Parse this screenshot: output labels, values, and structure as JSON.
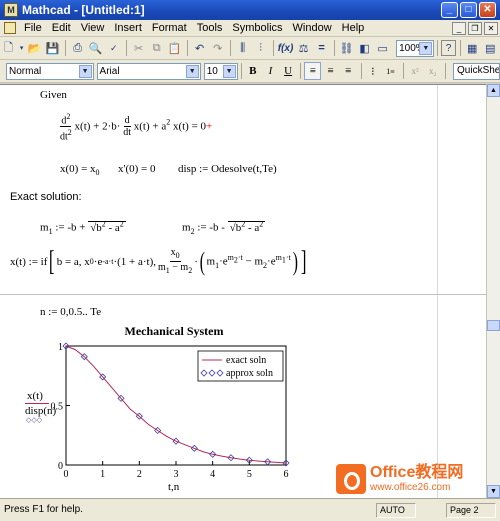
{
  "window": {
    "title": "Mathcad - [Untitled:1]",
    "app_icon": "mathcad-icon"
  },
  "menu": {
    "items": [
      "File",
      "Edit",
      "View",
      "Insert",
      "Format",
      "Tools",
      "Symbolics",
      "Window",
      "Help"
    ]
  },
  "toolbar": {
    "zoom": "100%",
    "help_label": "?"
  },
  "format_bar": {
    "style": "Normal",
    "font": "Arial",
    "size": "10",
    "bold": "B",
    "italic": "I",
    "underline": "U",
    "quicksheets": "QuickShe"
  },
  "worksheet": {
    "given": "Given",
    "ode_lhs": "x(t) + 2·b·",
    "ode_d": "d",
    "ode_dt": "dt",
    "ode_mid": "x(t) + a",
    "ode_rhs": "x(t) = 0",
    "ic1": "x(0) = x",
    "ic1_sub": "0",
    "ic2": "x'(0) = 0",
    "solve": "disp := Odesolve(t,Te)",
    "exact_label": "Exact solution:",
    "m1": "m",
    "m1_sub": "1",
    "m1_def": ":= -b + ",
    "m2_sub": "2",
    "m2_def": ":= -b - ",
    "sqrt_expr": "b",
    "sqrt_rest": " - a",
    "x_def": "x(t) := if",
    "if_body": "b = a, x",
    "if_exp": "-a·t",
    "if_mid": "·(1 + a·t),",
    "frac_num": "x",
    "frac_den": "m",
    "inner": "m",
    "n_range": "n := 0,0.5.. Te"
  },
  "chart_data": {
    "type": "line",
    "title": "Mechanical System",
    "xlabel": "t,n",
    "ylabel": "x(t)",
    "ylabel2": "disp(n)",
    "ylabel3": "◇◇◇",
    "xlim": [
      0,
      6
    ],
    "ylim": [
      0,
      1
    ],
    "xticks": [
      "0",
      "1",
      "2",
      "3",
      "4",
      "5",
      "6"
    ],
    "yticks": [
      "0",
      "0.5",
      "1"
    ],
    "legend_position": "top-right",
    "series": [
      {
        "name": "exact soln",
        "color": "#b4285a",
        "x": [
          0,
          0.25,
          0.5,
          0.75,
          1,
          1.25,
          1.5,
          1.75,
          2,
          2.25,
          2.5,
          2.75,
          3,
          3.25,
          3.5,
          3.75,
          4,
          4.25,
          4.5,
          4.75,
          5,
          5.25,
          5.5,
          5.75,
          6
        ],
        "y": [
          1.0,
          0.97,
          0.91,
          0.83,
          0.74,
          0.65,
          0.56,
          0.47,
          0.41,
          0.34,
          0.29,
          0.24,
          0.2,
          0.17,
          0.14,
          0.11,
          0.09,
          0.075,
          0.061,
          0.05,
          0.04,
          0.033,
          0.027,
          0.022,
          0.017
        ]
      },
      {
        "name": "approx soln",
        "color": "#4040a0",
        "x": [
          0,
          0.5,
          1,
          1.5,
          2,
          2.5,
          3,
          3.5,
          4,
          4.5,
          5,
          5.5,
          6
        ],
        "y": [
          1.0,
          0.91,
          0.74,
          0.56,
          0.41,
          0.29,
          0.2,
          0.14,
          0.09,
          0.061,
          0.04,
          0.027,
          0.017
        ]
      }
    ]
  },
  "status": {
    "hint": "Press F1 for help.",
    "mode": "AUTO",
    "page": "Page 2"
  },
  "watermark": {
    "brand": "Office教程网",
    "url": "www.office26.com"
  }
}
